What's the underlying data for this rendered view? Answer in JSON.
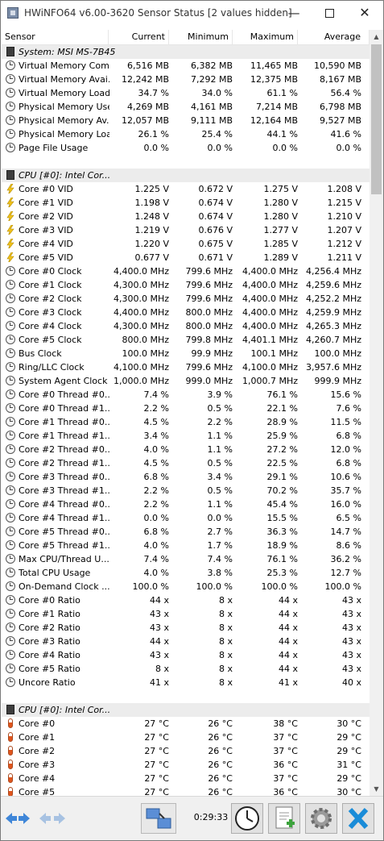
{
  "window": {
    "title": "HWiNFO64 v6.00-3620 Sensor Status [2 values hidden]"
  },
  "columns": {
    "sensor": "Sensor",
    "current": "Current",
    "minimum": "Minimum",
    "maximum": "Maximum",
    "average": "Average"
  },
  "rows": [
    {
      "type": "section",
      "name": "System: MSI MS-7B45",
      "icon": "chip-icon"
    },
    {
      "type": "data",
      "icon": "clock-icon",
      "name": "Virtual Memory Com...",
      "cur": "6,516 MB",
      "min": "6,382 MB",
      "max": "11,465 MB",
      "avg": "10,590 MB"
    },
    {
      "type": "data",
      "icon": "clock-icon",
      "name": "Virtual Memory Avai...",
      "cur": "12,242 MB",
      "min": "7,292 MB",
      "max": "12,375 MB",
      "avg": "8,167 MB"
    },
    {
      "type": "data",
      "icon": "clock-icon",
      "name": "Virtual Memory Load",
      "cur": "34.7 %",
      "min": "34.0 %",
      "max": "61.1 %",
      "avg": "56.4 %"
    },
    {
      "type": "data",
      "icon": "clock-icon",
      "name": "Physical Memory Used",
      "cur": "4,269 MB",
      "min": "4,161 MB",
      "max": "7,214 MB",
      "avg": "6,798 MB"
    },
    {
      "type": "data",
      "icon": "clock-icon",
      "name": "Physical Memory Av...",
      "cur": "12,057 MB",
      "min": "9,111 MB",
      "max": "12,164 MB",
      "avg": "9,527 MB"
    },
    {
      "type": "data",
      "icon": "clock-icon",
      "name": "Physical Memory Load",
      "cur": "26.1 %",
      "min": "25.4 %",
      "max": "44.1 %",
      "avg": "41.6 %"
    },
    {
      "type": "data",
      "icon": "clock-icon",
      "name": "Page File Usage",
      "cur": "0.0 %",
      "min": "0.0 %",
      "max": "0.0 %",
      "avg": "0.0 %"
    },
    {
      "type": "blank"
    },
    {
      "type": "section",
      "name": "CPU [#0]: Intel Cor...",
      "icon": "chip-icon"
    },
    {
      "type": "data",
      "icon": "voltage-icon",
      "name": "Core #0 VID",
      "cur": "1.225 V",
      "min": "0.672 V",
      "max": "1.275 V",
      "avg": "1.208 V"
    },
    {
      "type": "data",
      "icon": "voltage-icon",
      "name": "Core #1 VID",
      "cur": "1.198 V",
      "min": "0.674 V",
      "max": "1.280 V",
      "avg": "1.215 V"
    },
    {
      "type": "data",
      "icon": "voltage-icon",
      "name": "Core #2 VID",
      "cur": "1.248 V",
      "min": "0.674 V",
      "max": "1.280 V",
      "avg": "1.210 V"
    },
    {
      "type": "data",
      "icon": "voltage-icon",
      "name": "Core #3 VID",
      "cur": "1.219 V",
      "min": "0.676 V",
      "max": "1.277 V",
      "avg": "1.207 V"
    },
    {
      "type": "data",
      "icon": "voltage-icon",
      "name": "Core #4 VID",
      "cur": "1.220 V",
      "min": "0.675 V",
      "max": "1.285 V",
      "avg": "1.212 V"
    },
    {
      "type": "data",
      "icon": "voltage-icon",
      "name": "Core #5 VID",
      "cur": "0.677 V",
      "min": "0.671 V",
      "max": "1.289 V",
      "avg": "1.211 V"
    },
    {
      "type": "data",
      "icon": "clock-icon",
      "name": "Core #0 Clock",
      "cur": "4,400.0 MHz",
      "min": "799.6 MHz",
      "max": "4,400.0 MHz",
      "avg": "4,256.4 MHz"
    },
    {
      "type": "data",
      "icon": "clock-icon",
      "name": "Core #1 Clock",
      "cur": "4,300.0 MHz",
      "min": "799.6 MHz",
      "max": "4,400.0 MHz",
      "avg": "4,259.6 MHz"
    },
    {
      "type": "data",
      "icon": "clock-icon",
      "name": "Core #2 Clock",
      "cur": "4,300.0 MHz",
      "min": "799.6 MHz",
      "max": "4,400.0 MHz",
      "avg": "4,252.2 MHz"
    },
    {
      "type": "data",
      "icon": "clock-icon",
      "name": "Core #3 Clock",
      "cur": "4,400.0 MHz",
      "min": "800.0 MHz",
      "max": "4,400.0 MHz",
      "avg": "4,259.9 MHz"
    },
    {
      "type": "data",
      "icon": "clock-icon",
      "name": "Core #4 Clock",
      "cur": "4,300.0 MHz",
      "min": "800.0 MHz",
      "max": "4,400.0 MHz",
      "avg": "4,265.3 MHz"
    },
    {
      "type": "data",
      "icon": "clock-icon",
      "name": "Core #5 Clock",
      "cur": "800.0 MHz",
      "min": "799.8 MHz",
      "max": "4,401.1 MHz",
      "avg": "4,260.7 MHz"
    },
    {
      "type": "data",
      "icon": "clock-icon",
      "name": "Bus Clock",
      "cur": "100.0 MHz",
      "min": "99.9 MHz",
      "max": "100.1 MHz",
      "avg": "100.0 MHz"
    },
    {
      "type": "data",
      "icon": "clock-icon",
      "name": "Ring/LLC Clock",
      "cur": "4,100.0 MHz",
      "min": "799.6 MHz",
      "max": "4,100.0 MHz",
      "avg": "3,957.6 MHz"
    },
    {
      "type": "data",
      "icon": "clock-icon",
      "name": "System Agent Clock",
      "cur": "1,000.0 MHz",
      "min": "999.0 MHz",
      "max": "1,000.7 MHz",
      "avg": "999.9 MHz"
    },
    {
      "type": "data",
      "icon": "clock-icon",
      "name": "Core #0 Thread #0...",
      "cur": "7.4 %",
      "min": "3.9 %",
      "max": "76.1 %",
      "avg": "15.6 %"
    },
    {
      "type": "data",
      "icon": "clock-icon",
      "name": "Core #0 Thread #1...",
      "cur": "2.2 %",
      "min": "0.5 %",
      "max": "22.1 %",
      "avg": "7.6 %"
    },
    {
      "type": "data",
      "icon": "clock-icon",
      "name": "Core #1 Thread #0...",
      "cur": "4.5 %",
      "min": "2.2 %",
      "max": "28.9 %",
      "avg": "11.5 %"
    },
    {
      "type": "data",
      "icon": "clock-icon",
      "name": "Core #1 Thread #1...",
      "cur": "3.4 %",
      "min": "1.1 %",
      "max": "25.9 %",
      "avg": "6.8 %"
    },
    {
      "type": "data",
      "icon": "clock-icon",
      "name": "Core #2 Thread #0...",
      "cur": "4.0 %",
      "min": "1.1 %",
      "max": "27.2 %",
      "avg": "12.0 %"
    },
    {
      "type": "data",
      "icon": "clock-icon",
      "name": "Core #2 Thread #1...",
      "cur": "4.5 %",
      "min": "0.5 %",
      "max": "22.5 %",
      "avg": "6.8 %"
    },
    {
      "type": "data",
      "icon": "clock-icon",
      "name": "Core #3 Thread #0...",
      "cur": "6.8 %",
      "min": "3.4 %",
      "max": "29.1 %",
      "avg": "10.6 %"
    },
    {
      "type": "data",
      "icon": "clock-icon",
      "name": "Core #3 Thread #1...",
      "cur": "2.2 %",
      "min": "0.5 %",
      "max": "70.2 %",
      "avg": "35.7 %"
    },
    {
      "type": "data",
      "icon": "clock-icon",
      "name": "Core #4 Thread #0...",
      "cur": "2.2 %",
      "min": "1.1 %",
      "max": "45.4 %",
      "avg": "16.0 %"
    },
    {
      "type": "data",
      "icon": "clock-icon",
      "name": "Core #4 Thread #1...",
      "cur": "0.0 %",
      "min": "0.0 %",
      "max": "15.5 %",
      "avg": "6.5 %"
    },
    {
      "type": "data",
      "icon": "clock-icon",
      "name": "Core #5 Thread #0...",
      "cur": "6.8 %",
      "min": "2.7 %",
      "max": "36.3 %",
      "avg": "14.7 %"
    },
    {
      "type": "data",
      "icon": "clock-icon",
      "name": "Core #5 Thread #1...",
      "cur": "4.0 %",
      "min": "1.7 %",
      "max": "18.9 %",
      "avg": "8.6 %"
    },
    {
      "type": "data",
      "icon": "clock-icon",
      "name": "Max CPU/Thread U...",
      "cur": "7.4 %",
      "min": "7.4 %",
      "max": "76.1 %",
      "avg": "36.2 %"
    },
    {
      "type": "data",
      "icon": "clock-icon",
      "name": "Total CPU Usage",
      "cur": "4.0 %",
      "min": "3.8 %",
      "max": "25.3 %",
      "avg": "12.7 %"
    },
    {
      "type": "data",
      "icon": "clock-icon",
      "name": "On-Demand Clock ...",
      "cur": "100.0 %",
      "min": "100.0 %",
      "max": "100.0 %",
      "avg": "100.0 %"
    },
    {
      "type": "data",
      "icon": "clock-icon",
      "name": "Core #0 Ratio",
      "cur": "44 x",
      "min": "8 x",
      "max": "44 x",
      "avg": "43 x"
    },
    {
      "type": "data",
      "icon": "clock-icon",
      "name": "Core #1 Ratio",
      "cur": "43 x",
      "min": "8 x",
      "max": "44 x",
      "avg": "43 x"
    },
    {
      "type": "data",
      "icon": "clock-icon",
      "name": "Core #2 Ratio",
      "cur": "43 x",
      "min": "8 x",
      "max": "44 x",
      "avg": "43 x"
    },
    {
      "type": "data",
      "icon": "clock-icon",
      "name": "Core #3 Ratio",
      "cur": "44 x",
      "min": "8 x",
      "max": "44 x",
      "avg": "43 x"
    },
    {
      "type": "data",
      "icon": "clock-icon",
      "name": "Core #4 Ratio",
      "cur": "43 x",
      "min": "8 x",
      "max": "44 x",
      "avg": "43 x"
    },
    {
      "type": "data",
      "icon": "clock-icon",
      "name": "Core #5 Ratio",
      "cur": "8 x",
      "min": "8 x",
      "max": "44 x",
      "avg": "43 x"
    },
    {
      "type": "data",
      "icon": "clock-icon",
      "name": "Uncore Ratio",
      "cur": "41 x",
      "min": "8 x",
      "max": "41 x",
      "avg": "40 x"
    },
    {
      "type": "blank"
    },
    {
      "type": "section",
      "name": "CPU [#0]: Intel Cor...",
      "icon": "chip-icon"
    },
    {
      "type": "data",
      "icon": "thermometer-icon",
      "name": "Core #0",
      "cur": "27 °C",
      "min": "26 °C",
      "max": "38 °C",
      "avg": "30 °C"
    },
    {
      "type": "data",
      "icon": "thermometer-icon",
      "name": "Core #1",
      "cur": "27 °C",
      "min": "26 °C",
      "max": "37 °C",
      "avg": "29 °C"
    },
    {
      "type": "data",
      "icon": "thermometer-icon",
      "name": "Core #2",
      "cur": "27 °C",
      "min": "26 °C",
      "max": "37 °C",
      "avg": "29 °C"
    },
    {
      "type": "data",
      "icon": "thermometer-icon",
      "name": "Core #3",
      "cur": "27 °C",
      "min": "26 °C",
      "max": "36 °C",
      "avg": "31 °C"
    },
    {
      "type": "data",
      "icon": "thermometer-icon",
      "name": "Core #4",
      "cur": "27 °C",
      "min": "26 °C",
      "max": "37 °C",
      "avg": "29 °C"
    },
    {
      "type": "data",
      "icon": "thermometer-icon",
      "name": "Core #5",
      "cur": "27 °C",
      "min": "26 °C",
      "max": "36 °C",
      "avg": "30 °C"
    }
  ],
  "toolbar": {
    "timer": "0:29:33",
    "buttons": [
      "navigate-arrows-icon",
      "disabled-navigate-arrows-icon",
      "network-icon",
      "clock-icon",
      "report-icon",
      "settings-gear-icon",
      "close-x-icon"
    ]
  },
  "colors": {
    "section_bg": "#ececec",
    "close_x": "#1a8cd8",
    "arrows": "#3f86d8"
  }
}
